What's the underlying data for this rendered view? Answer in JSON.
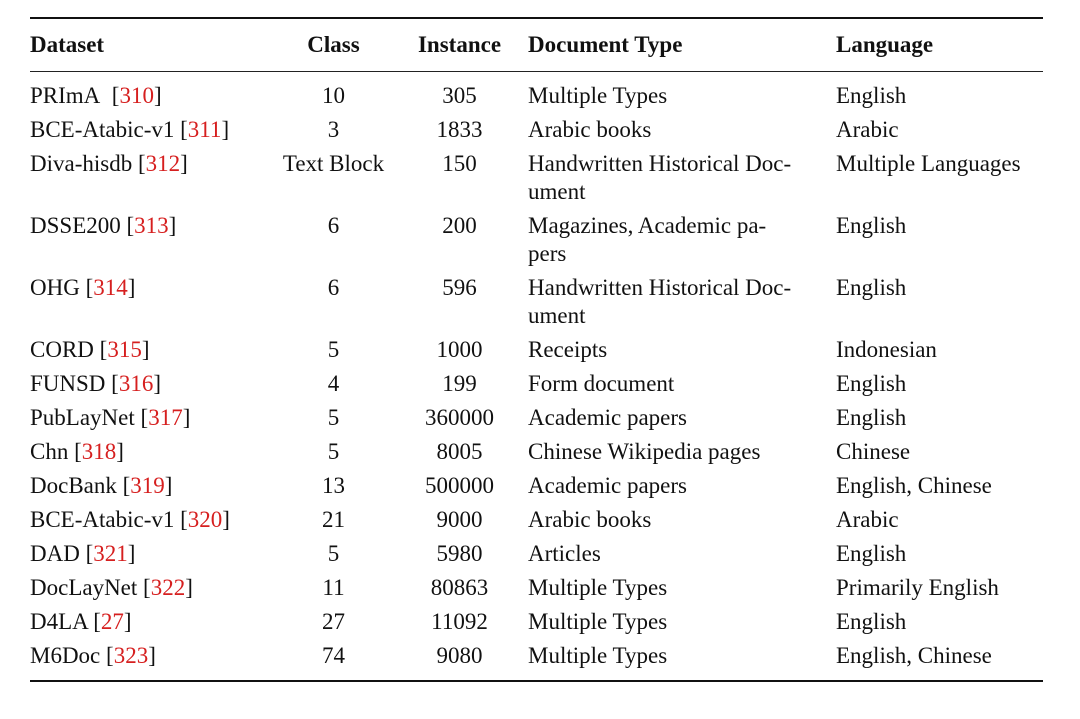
{
  "table": {
    "headers": [
      "Dataset",
      "Class",
      "Instance",
      "Document Type",
      "Language"
    ],
    "citation_color": "#d61f1f",
    "rows": [
      {
        "dataset": "PRImA",
        "cite": "310",
        "cls": "10",
        "instance": "305",
        "doc_type": "Multiple Types",
        "language": "English"
      },
      {
        "dataset": "BCE-Atabic-v1",
        "cite": "311",
        "cls": "3",
        "instance": "1833",
        "doc_type": "Arabic books",
        "language": "Arabic"
      },
      {
        "dataset": "Diva-hisdb",
        "cite": "312",
        "cls": "Text Block",
        "instance": "150",
        "doc_type": "Handwritten Historical Doc-ument",
        "language": "Multiple Languages"
      },
      {
        "dataset": "DSSE200",
        "cite": "313",
        "cls": "6",
        "instance": "200",
        "doc_type": "Magazines, Academic pa-pers",
        "language": "English"
      },
      {
        "dataset": "OHG",
        "cite": "314",
        "cls": "6",
        "instance": "596",
        "doc_type": "Handwritten Historical Doc-ument",
        "language": "English"
      },
      {
        "dataset": "CORD",
        "cite": "315",
        "cls": "5",
        "instance": "1000",
        "doc_type": "Receipts",
        "language": "Indonesian"
      },
      {
        "dataset": "FUNSD",
        "cite": "316",
        "cls": "4",
        "instance": "199",
        "doc_type": "Form document",
        "language": "English"
      },
      {
        "dataset": "PubLayNet",
        "cite": "317",
        "cls": "5",
        "instance": "360000",
        "doc_type": "Academic papers",
        "language": "English"
      },
      {
        "dataset": "Chn",
        "cite": "318",
        "cls": "5",
        "instance": "8005",
        "doc_type": "Chinese Wikipedia pages",
        "language": "Chinese"
      },
      {
        "dataset": "DocBank",
        "cite": "319",
        "cls": "13",
        "instance": "500000",
        "doc_type": "Academic papers",
        "language": "English, Chinese"
      },
      {
        "dataset": "BCE-Atabic-v1",
        "cite": "320",
        "cls": "21",
        "instance": "9000",
        "doc_type": "Arabic books",
        "language": "Arabic"
      },
      {
        "dataset": "DAD",
        "cite": "321",
        "cls": "5",
        "instance": "5980",
        "doc_type": "Articles",
        "language": "English"
      },
      {
        "dataset": "DocLayNet",
        "cite": "322",
        "cls": "11",
        "instance": "80863",
        "doc_type": "Multiple Types",
        "language": "Primarily English"
      },
      {
        "dataset": "D4LA",
        "cite": "27",
        "cls": "27",
        "instance": "11092",
        "doc_type": "Multiple Types",
        "language": "English"
      },
      {
        "dataset": "M6Doc",
        "cite": "323",
        "cls": "74",
        "instance": "9080",
        "doc_type": "Multiple Types",
        "language": "English, Chinese"
      }
    ]
  }
}
